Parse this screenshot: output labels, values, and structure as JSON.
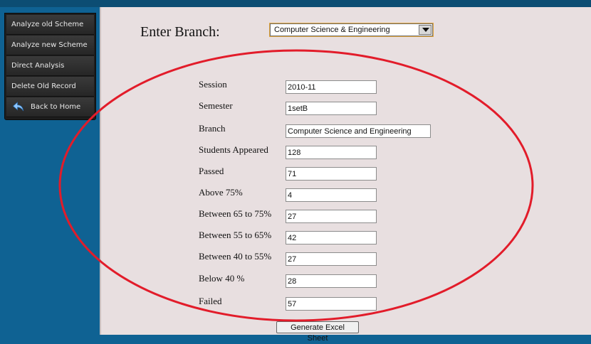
{
  "sidebar": {
    "items": [
      {
        "label": "Analyze old Scheme"
      },
      {
        "label": "Analyze new Scheme"
      },
      {
        "label": "Direct Analysis"
      },
      {
        "label": "Delete Old Record"
      },
      {
        "label": "Back to Home",
        "icon": "back-arrow-icon"
      }
    ]
  },
  "branch": {
    "label": "Enter Branch:",
    "selected": "Computer Science & Engineering"
  },
  "form": {
    "rows": [
      {
        "label": "Session",
        "value": "2010-11"
      },
      {
        "label": "Semester",
        "value": "1setB"
      },
      {
        "label": "Branch",
        "value": "Computer Science and Engineering"
      },
      {
        "label": "Students Appeared",
        "value": "128"
      },
      {
        "label": "Passed",
        "value": "71"
      },
      {
        "label": "Above 75%",
        "value": "4"
      },
      {
        "label": "Between 65 to 75%",
        "value": "27"
      },
      {
        "label": "Between 55 to 65%",
        "value": "42"
      },
      {
        "label": "Between 40 to 55%",
        "value": "27"
      },
      {
        "label": "Below 40 %",
        "value": "28"
      },
      {
        "label": "Failed",
        "value": "57"
      }
    ]
  },
  "actions": {
    "generate_label": "Generate Excel Sheet"
  },
  "colors": {
    "annotation": "#e21c2a",
    "sidebar": "#0f6293",
    "content": "#e8dfe0"
  }
}
